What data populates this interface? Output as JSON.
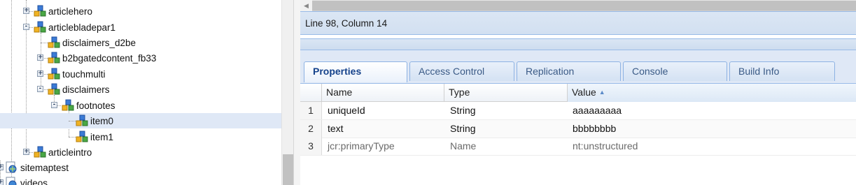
{
  "tree": {
    "nodes": [
      {
        "label": "articlehero",
        "expander": "+",
        "level": 3,
        "selected": false
      },
      {
        "label": "articlebladepar1",
        "expander": "-",
        "level": 3,
        "selected": false
      },
      {
        "label": "disclaimers_d2be",
        "expander": "",
        "level": 4,
        "selected": false
      },
      {
        "label": "b2bgatedcontent_fb33",
        "expander": "+",
        "level": 4,
        "selected": false
      },
      {
        "label": "touchmulti",
        "expander": "+",
        "level": 4,
        "selected": false
      },
      {
        "label": "disclaimers",
        "expander": "-",
        "level": 4,
        "selected": false
      },
      {
        "label": "footnotes",
        "expander": "-",
        "level": 5,
        "selected": false
      },
      {
        "label": "item0",
        "expander": "",
        "level": 6,
        "selected": true
      },
      {
        "label": "item1",
        "expander": "",
        "level": 6,
        "selected": false
      },
      {
        "label": "articleintro",
        "expander": "+",
        "level": 3,
        "selected": false
      },
      {
        "label": "sitemaptest",
        "expander": "+",
        "level": 1,
        "selected": false
      },
      {
        "label": "videos",
        "expander": "+",
        "level": 1,
        "selected": false
      }
    ]
  },
  "editor": {
    "scroll_left_icon": "◀",
    "status": "Line 98, Column 14"
  },
  "tabs": [
    {
      "label": "Properties",
      "active": true
    },
    {
      "label": "Access Control",
      "active": false
    },
    {
      "label": "Replication",
      "active": false
    },
    {
      "label": "Console",
      "active": false
    },
    {
      "label": "Build Info",
      "active": false
    }
  ],
  "grid": {
    "columns": [
      {
        "label": "Name",
        "sorted": false
      },
      {
        "label": "Type",
        "sorted": false
      },
      {
        "label": "Value",
        "sorted": true,
        "sort_icon": "▲"
      }
    ],
    "rows": [
      {
        "num": "1",
        "name": "uniqueId",
        "type": "String",
        "value": "aaaaaaaaa",
        "inherited": false
      },
      {
        "num": "2",
        "name": "text",
        "type": "String",
        "value": "bbbbbbbb",
        "inherited": false
      },
      {
        "num": "3",
        "name": "jcr:primaryType",
        "type": "Name",
        "value": "nt:unstructured",
        "inherited": true
      }
    ]
  },
  "colors": {
    "accent": "#15428b",
    "tab_border": "#99bbe8",
    "selection": "#dfe8f6"
  }
}
